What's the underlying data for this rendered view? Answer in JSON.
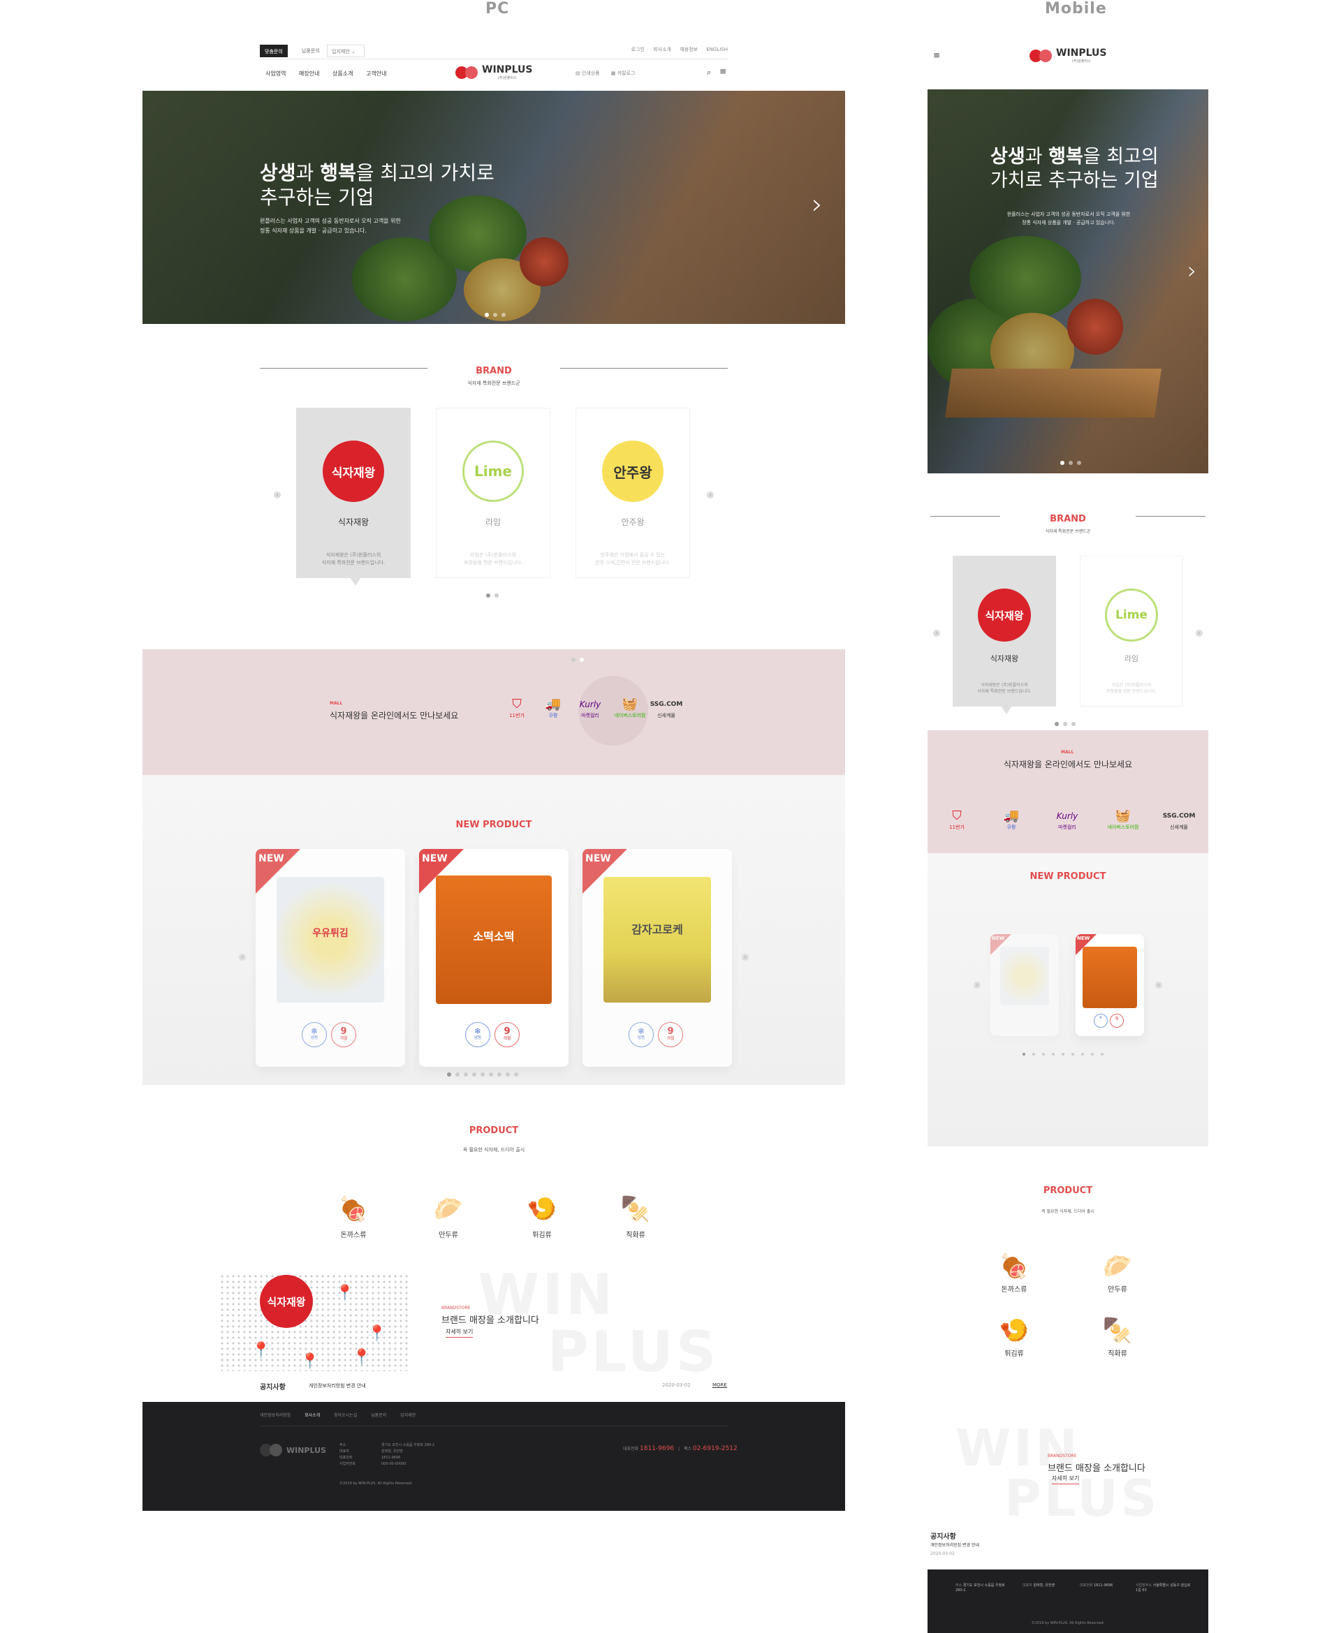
{
  "labels": {
    "pc": "PC",
    "mobile": "Mobile"
  },
  "pc": {
    "topbar": {
      "btn1": "맞춤문의",
      "btn2": "납품문의",
      "btn3": "입지제안",
      "links": [
        "로그인",
        "회사소개",
        "채용정보",
        "ENGLISH"
      ]
    },
    "nav": {
      "menu": [
        "사업영역",
        "매장안내",
        "상품소개",
        "고객안내"
      ],
      "logo_text": "WINPLUS",
      "logo_sub": "(주)윈플러스",
      "util": [
        "인쇄상품",
        "카탈로그"
      ],
      "search_icon": "search-icon",
      "menu_icon": "hamburger-icon"
    },
    "hero": {
      "title_line1_a": "상생",
      "title_line1_b": "과 ",
      "title_line1_c": "행복",
      "title_line1_d": "을 최고의 가치로",
      "title_line2": "추구하는 기업",
      "sub1": "윈플러스는 사업자 고객의 성공 동반자로서 오직 고객을 위한",
      "sub2": "정통 식자재 상품을 개발 · 공급하고 있습니다."
    },
    "brand": {
      "title": "BRAND",
      "subtitle": "식자재 특화전문 브랜드군",
      "cards": [
        {
          "logo": "식자재왕",
          "name": "식자재왕",
          "desc1": "식자재왕은 (주)윈플러스의",
          "desc2": "식자재 특화전문 브랜드입니다."
        },
        {
          "logo": "Lime",
          "name": "라임",
          "desc1": "라임은 (주)윈플러스의",
          "desc2": "포장용품 전문 브랜드입니다."
        },
        {
          "logo": "안주왕",
          "name": "안주왕",
          "desc1": "안주왕은 가정에서 즐길 수 있는",
          "desc2": "안주 스낵,간편식 전문 브랜드입니다."
        }
      ]
    },
    "mall": {
      "tag": "MALL",
      "text_a": "식자재왕",
      "text_b": "을 온라인에서도 만나보세요",
      "shops": [
        {
          "glyph": "⛉",
          "label": "11번가"
        },
        {
          "glyph": "🚚",
          "label": "쿠팡"
        },
        {
          "glyph": "Kurly",
          "label": "마켓컬리"
        },
        {
          "glyph": "🧺",
          "label": "네이버스토어팜"
        },
        {
          "glyph": "SSG.COM",
          "label": "신세계몰"
        }
      ]
    },
    "new_product": {
      "title": "NEW PRODUCT",
      "ribbon": "NEW",
      "items": [
        {
          "pack_text": "우유튀김",
          "b1_icon": "❄",
          "b1": "냉동",
          "b2_num": "9",
          "b2": "개월"
        },
        {
          "pack_text": "소떡소떡",
          "b1_icon": "❄",
          "b1": "냉동",
          "b2_num": "9",
          "b2": "개월"
        },
        {
          "pack_text": "감자고로케",
          "b1_icon": "❄",
          "b1": "냉동",
          "b2_num": "9",
          "b2": "개월"
        }
      ]
    },
    "product": {
      "title": "PRODUCT",
      "subtitle": "꼭 필요한 식자재, 드디어 출시",
      "cats": [
        {
          "icon": "🍖",
          "label": "돈까스류"
        },
        {
          "icon": "🥟",
          "label": "만두류"
        },
        {
          "icon": "🍤",
          "label": "튀김류"
        },
        {
          "icon": "🍢",
          "label": "직화류"
        }
      ]
    },
    "store": {
      "logo": "식자재왕",
      "tag": "BRANDSTORE",
      "text_a": "브랜드 매장",
      "text_b": "을 소개합니다",
      "link": "자세히 보기",
      "bg_word1": "WIN",
      "bg_word2": "PLUS"
    },
    "notice": {
      "title": "공지사항",
      "item": "개인정보처리방침 변경 안내",
      "date": "2020-03-02",
      "more": "MORE"
    },
    "footer": {
      "links": [
        "개인정보처리방침",
        "회사소개",
        "찾아오시는길",
        "납품문의",
        "입지제안"
      ],
      "logo": "WINPLUS",
      "info_labels": [
        "주소",
        "대표자",
        "대표전화",
        "사업자번호"
      ],
      "info_values": [
        "경기도 포천시 소흘읍 우정로 280-2",
        "윈태형, 유한영",
        "1811-9696",
        "000-00-00000"
      ],
      "phone_label1": "대표전화",
      "phone1": "1811-9696",
      "phone_label2": "팩스",
      "phone2": "02-6919-2512",
      "copyright": "©2019 by WIN-PLUS. All Rights Reserved."
    }
  },
  "mobile": {
    "logo_text": "WINPLUS",
    "logo_sub": "(주)윈플러스",
    "hero": {
      "title_line1_a": "상생",
      "title_line1_b": "과 ",
      "title_line1_c": "행복",
      "title_line1_d": "을 최고의",
      "title_line2": "가치로 추구하는 기업",
      "sub1": "윈플러스는 사업자 고객의 성공 동반자로서 오직 고객을 위한",
      "sub2": "정통 식자재 상품을 개발 · 공급하고 있습니다."
    },
    "brand": {
      "title": "BRAND",
      "subtitle": "식자재 특화전문 브랜드군",
      "cards": [
        {
          "logo": "식자재왕",
          "name": "식자재왕",
          "desc1": "식자재왕은 (주)윈플러스의",
          "desc2": "식자재 특화전문 브랜드입니다."
        },
        {
          "logo": "Lime",
          "name": "라임",
          "desc1": "라임은 (주)윈플러스의",
          "desc2": "포장용품 전문 브랜드입니다."
        }
      ]
    },
    "mall": {
      "tag": "MALL",
      "text_a": "식자재왕",
      "text_b": "을 온라인에서도 만나보세요"
    },
    "new_product": {
      "title": "NEW PRODUCT",
      "ribbon": "NEW"
    },
    "product": {
      "title": "PRODUCT",
      "subtitle": "꼭 필요한 식자재, 드디어 출시"
    },
    "store": {
      "tag": "BRANDSTORE",
      "text_a": "브랜드 매장",
      "text_b": "을 소개합니다",
      "link": "자세히 보기",
      "bg_word1": "WIN",
      "bg_word2": "PLUS"
    },
    "notice": {
      "title": "공지사항",
      "item": "개인정보처리방침 변경 안내",
      "date": "2020-03-02"
    },
    "footer": {
      "cols": [
        {
          "k": "주소",
          "v": "경기도 포천시 소흘읍 우정로 280-2"
        },
        {
          "k": "대표자",
          "v": "윈태형, 유한영"
        },
        {
          "k": "대표전화",
          "v": "1811-9696"
        },
        {
          "k": "사업장주소",
          "v": "서울특별시 성동구 왕십로 1길 63"
        }
      ],
      "copyright": "©2019 by WIN-PLUS. All Rights Reserved."
    }
  },
  "colors": {
    "accent": "#e24d4d",
    "brand_red": "#d9222a",
    "mall_bg": "#ead9db",
    "footer_bg": "#1f1f21"
  }
}
